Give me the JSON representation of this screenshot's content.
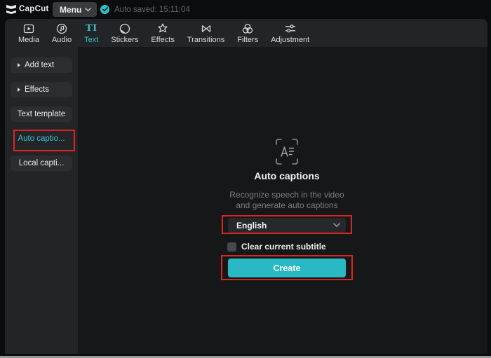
{
  "topbar": {
    "logo_text": "CapCut",
    "menu_label": "Menu",
    "autosave_status": "Auto saved: 15:11:04"
  },
  "toolbar": {
    "items": [
      {
        "label": "Media"
      },
      {
        "label": "Audio"
      },
      {
        "label": "Text",
        "active": true
      },
      {
        "label": "Stickers"
      },
      {
        "label": "Effects"
      },
      {
        "label": "Transitions"
      },
      {
        "label": "Filters"
      },
      {
        "label": "Adjustment"
      }
    ]
  },
  "sidebar": {
    "items": [
      {
        "label": "Add text",
        "arrow": true
      },
      {
        "label": "Effects",
        "arrow": true
      },
      {
        "label": "Text template"
      },
      {
        "label": "Auto captio...",
        "active": true,
        "annotated": true
      },
      {
        "label": "Local capti..."
      }
    ]
  },
  "main": {
    "title": "Auto captions",
    "description": [
      "Recognize speech in the video",
      "and generate auto captions"
    ],
    "language_select": {
      "value": "English"
    },
    "clear_checkbox": {
      "label": "Clear current subtitle",
      "checked": false
    },
    "create_button": {
      "label": "Create"
    }
  },
  "colors": {
    "accent_cyan": "#36c3cc",
    "create_button": "#29b9c4",
    "annotation_red": "#dd2424",
    "panel_dark": "#161719",
    "panel_gray": "#232428"
  }
}
